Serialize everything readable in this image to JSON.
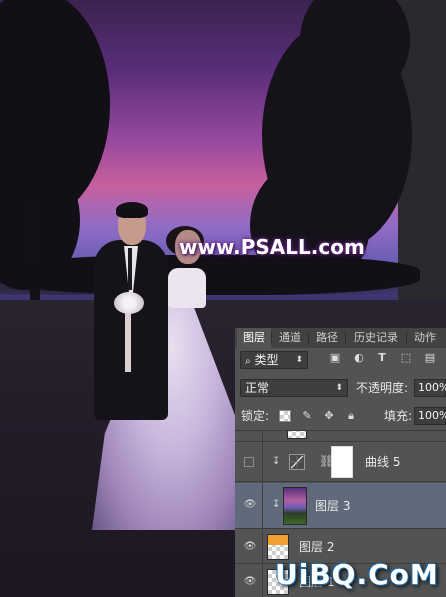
{
  "watermark": "www.PSALL.com",
  "panel": {
    "tabs": [
      "图层",
      "通道",
      "路径",
      "历史记录",
      "动作"
    ],
    "active_tab": "图层",
    "filter": {
      "label": "类型",
      "search_icon": "search-icon"
    },
    "filter_icons": [
      "image-filter-icon",
      "adjustment-filter-icon",
      "type-filter-icon",
      "shape-filter-icon",
      "smart-object-filter-icon"
    ],
    "blend_mode": "正常",
    "opacity_label": "不透明度:",
    "opacity_value": "100%",
    "lock_label": "锁定:",
    "fill_label": "填充:",
    "fill_value": "100%",
    "lock_icons": [
      "lock-transparent-icon",
      "lock-image-icon",
      "lock-position-icon",
      "lock-all-icon"
    ],
    "layers": [
      {
        "name": "",
        "visible": true,
        "kind": "partial"
      },
      {
        "name": "曲线 5",
        "visible": false,
        "kind": "curves",
        "clipped": true
      },
      {
        "name": "图层 3",
        "visible": true,
        "kind": "image",
        "clipped": true,
        "selected": true
      },
      {
        "name": "图层 2",
        "visible": true,
        "kind": "pixel"
      },
      {
        "name": "图层 1",
        "visible": true,
        "kind": "pixel"
      }
    ]
  },
  "logo": "UiBQ.CoM",
  "colors": {
    "panel_bg": "#535353",
    "selected_row": "#606a7a",
    "watermark_glow": "#6a2a8a"
  }
}
